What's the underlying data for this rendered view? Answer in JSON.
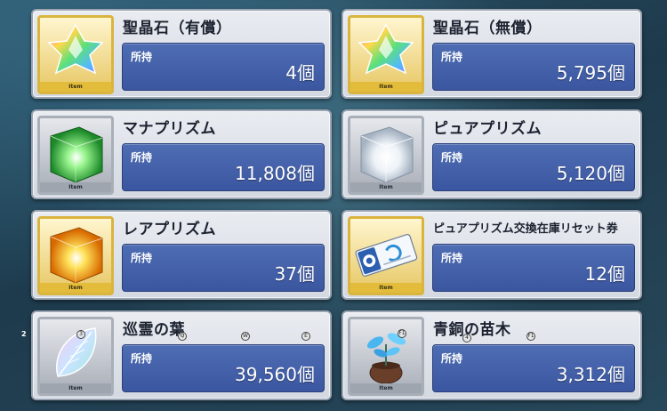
{
  "item_tag": "Item",
  "own_label": "所持",
  "items": [
    {
      "name": "聖晶石（有償）",
      "count": "4個",
      "icon": "rainbow-star-quartz-icon"
    },
    {
      "name": "聖晶石（無償）",
      "count": "5,795個",
      "icon": "rainbow-star-quartz-icon"
    },
    {
      "name": "マナプリズム",
      "count": "11,808個",
      "icon": "green-prism-cube-icon"
    },
    {
      "name": "ピュアプリズム",
      "count": "5,120個",
      "icon": "white-prism-cube-icon"
    },
    {
      "name": "レアプリズム",
      "count": "37個",
      "icon": "gold-prism-cube-icon"
    },
    {
      "name": "ピュアプリズム交換在庫リセット券",
      "count": "12個",
      "icon": "ticket-icon"
    },
    {
      "name": "巡霊の葉",
      "count": "39,560個",
      "icon": "crystal-leaf-icon"
    },
    {
      "name": "青銅の苗木",
      "count": "3,312個",
      "icon": "sapling-pot-icon"
    }
  ],
  "overlay_hints": {
    "corner": "2",
    "q": "Q",
    "w": "W",
    "e": "E",
    "f1a": "F1",
    "f1b": "F1",
    "three": "3",
    "four": "4"
  }
}
